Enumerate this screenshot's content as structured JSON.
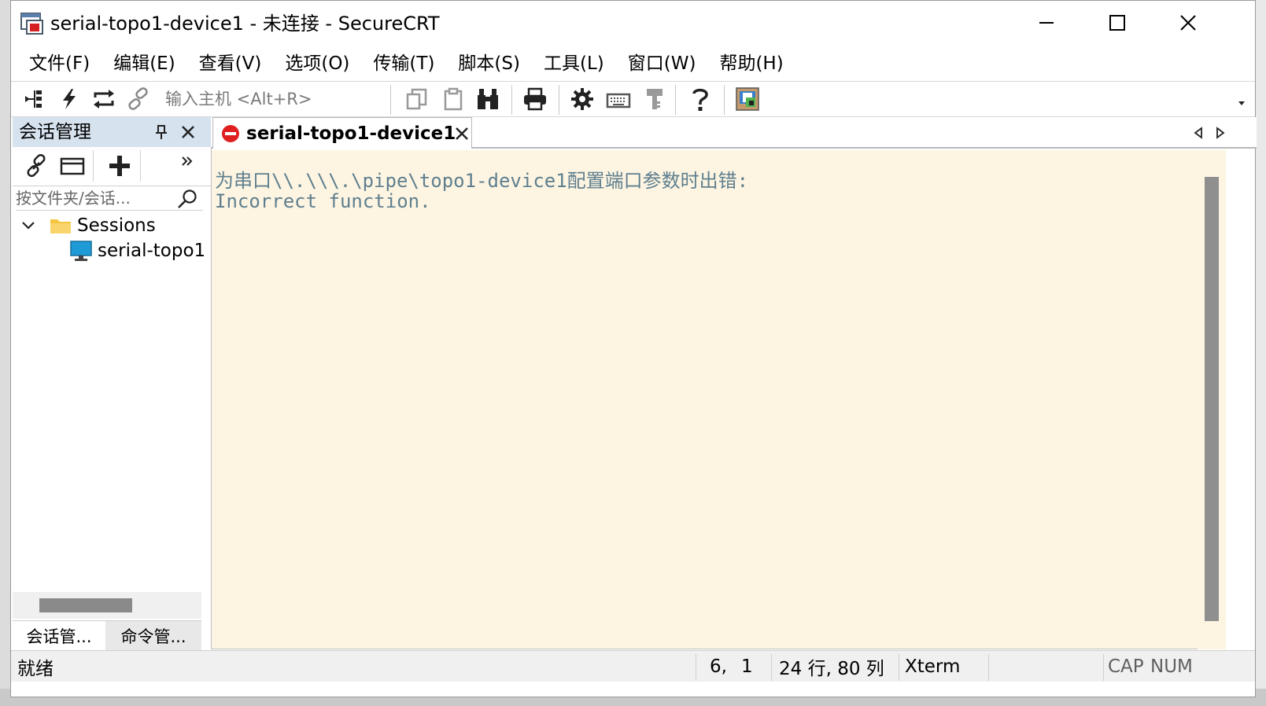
{
  "window": {
    "title": "serial-topo1-device1 - 未连接 - SecureCRT",
    "app_icon": "securecrt-app-icon",
    "controls": [
      "minimize-icon",
      "maximize-icon",
      "close-icon"
    ]
  },
  "menu": [
    {
      "label": "文件(F)"
    },
    {
      "label": "编辑(E)"
    },
    {
      "label": "查看(V)"
    },
    {
      "label": "选项(O)"
    },
    {
      "label": "传输(T)"
    },
    {
      "label": "脚本(S)"
    },
    {
      "label": "工具(L)"
    },
    {
      "label": "窗口(W)"
    },
    {
      "label": "帮助(H)"
    }
  ],
  "toolbar": {
    "host_placeholder": "输入主机 <Alt+R>",
    "icons": [
      "connect-tree-icon",
      "quick-connect-icon",
      "reconnect-icon",
      "disconnect-link-icon",
      "copy-icon",
      "paste-icon",
      "find-binoculars-icon",
      "print-icon",
      "settings-gear-icon",
      "keymap-keyboard-icon",
      "key-agent-icon",
      "help-icon",
      "sftp-icon",
      "toolbar-overflow-icon"
    ]
  },
  "session_manager": {
    "title": "会话管理",
    "filter_placeholder": "按文件夹/会话...",
    "tree": {
      "folder": "Sessions",
      "session": "serial-topo1"
    },
    "tabs": [
      "会话管...",
      "命令管..."
    ]
  },
  "session_tab": {
    "label": "serial-topo1-device1",
    "status": "disconnected"
  },
  "terminal": {
    "lines": [
      "为串口\\\\.\\\\\\.\\pipe\\topo1-device1配置端口参数时出错:",
      "Incorrect function."
    ],
    "background": "#fdf5e2",
    "text_color": "#5f7f8f"
  },
  "statusbar": {
    "status": "就绪",
    "cursor_row": "6,",
    "cursor_col": "1",
    "dimensions": "24 行, 80 列",
    "terminal_type": "Xterm",
    "cap": "CAP",
    "num": "NUM"
  },
  "colors": {
    "panel_header": "#d6e2ee",
    "error_red": "#e02020",
    "folder_yellow": "#f5c542",
    "monitor_blue": "#1e9ad6"
  }
}
